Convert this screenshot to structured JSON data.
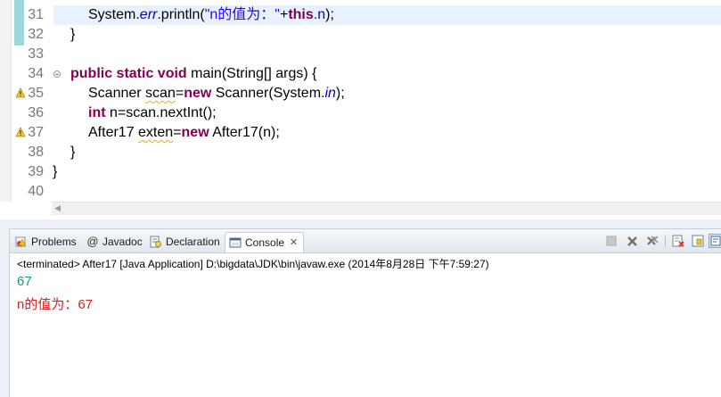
{
  "editor": {
    "line_numbers": [
      "31",
      "32",
      "33",
      "34",
      "35",
      "36",
      "37",
      "38",
      "39",
      "40"
    ],
    "warning_lines": [
      "35",
      "37"
    ],
    "fold_line": "34",
    "code": {
      "l31": {
        "recv": "System.",
        "err": "err",
        "call": ".println(",
        "str": "\"n的值为：\"",
        "plus": "+",
        "this_kw": "this",
        "field": ".n",
        "end": ");"
      },
      "l32": "}",
      "l34": {
        "kw": "public static void",
        "rest": " main(String[] args) {"
      },
      "l35": {
        "type": "Scanner ",
        "var": "scan",
        "eq": "=",
        "kw": "new",
        "ctor": " Scanner(System.",
        "in": "in",
        "end": ");"
      },
      "l36": {
        "kw": "int",
        "rest": " n=scan.nextInt();"
      },
      "l37": {
        "type": "After17 ",
        "var": "exten",
        "eq": "=",
        "kw": "new",
        "rest": " After17(n);"
      },
      "l38": "}",
      "l39": "}"
    }
  },
  "console": {
    "tabs": [
      {
        "label": "Problems",
        "icon": "problems-icon"
      },
      {
        "label": "Javadoc",
        "icon": "at-icon"
      },
      {
        "label": "Declaration",
        "icon": "declaration-icon"
      },
      {
        "label": "Console",
        "icon": "console-icon",
        "active": true
      }
    ],
    "status": "<terminated> After17 [Java Application] D:\\bigdata\\JDK\\bin\\javaw.exe (2014年8月28日 下午7:59:27)",
    "output": [
      "67",
      "n的值为：67"
    ],
    "colors": {
      "stdout": "#1d9a7c",
      "stderr": "#d81f1f",
      "keyword": "#7f0055",
      "string": "#2a00ff"
    }
  }
}
